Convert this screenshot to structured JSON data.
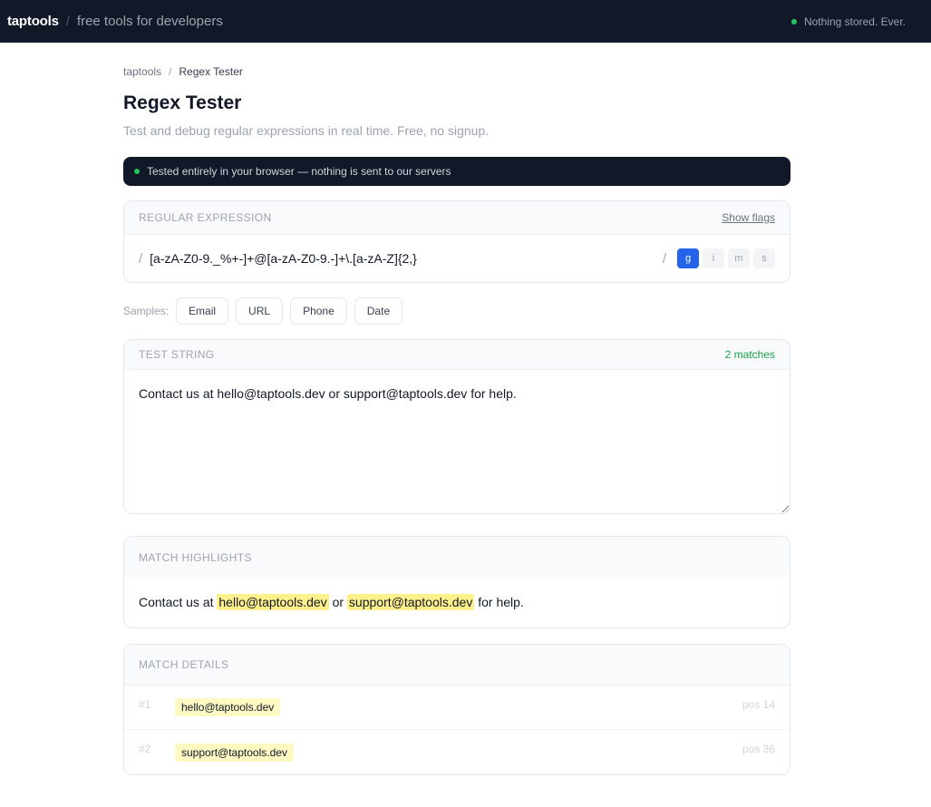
{
  "topbar": {
    "logo": "taptools",
    "separator": "/",
    "tagline": "free tools for developers",
    "status": "Nothing stored. Ever."
  },
  "breadcrumb": {
    "root": "taptools",
    "separator": "/",
    "current": "Regex Tester"
  },
  "page": {
    "title": "Regex Tester",
    "subtitle": "Test and debug regular expressions in real time. Free, no signup."
  },
  "privacy_banner": "Tested entirely in your browser — nothing is sent to our servers",
  "regex": {
    "title": "Regular Expression",
    "show_flags": "Show flags",
    "open_slash": "/",
    "close_slash": "/",
    "pattern": "[a-zA-Z0-9._%+-]+@[a-zA-Z0-9.-]+\\.[a-zA-Z]{2,}",
    "flags": [
      {
        "label": "g",
        "active": true
      },
      {
        "label": "i",
        "active": false
      },
      {
        "label": "m",
        "active": false
      },
      {
        "label": "s",
        "active": false
      }
    ]
  },
  "samples": {
    "label": "Samples:",
    "items": [
      "Email",
      "URL",
      "Phone",
      "Date"
    ]
  },
  "test_string": {
    "title": "Test String",
    "match_count": "2 matches",
    "value": "Contact us at hello@taptools.dev or support@taptools.dev for help."
  },
  "highlights": {
    "title": "Match Highlights",
    "segments": [
      {
        "text": "Contact us at ",
        "match": false
      },
      {
        "text": "hello@taptools.dev",
        "match": true
      },
      {
        "text": " or ",
        "match": false
      },
      {
        "text": "support@taptools.dev",
        "match": true
      },
      {
        "text": " for help.",
        "match": false
      }
    ]
  },
  "details": {
    "title": "Match Details",
    "rows": [
      {
        "index": "#1",
        "match": "hello@taptools.dev",
        "pos": "pos 14"
      },
      {
        "index": "#2",
        "match": "support@taptools.dev",
        "pos": "pos 36"
      }
    ]
  },
  "colors": {
    "topbar_bg": "#111827",
    "accent": "#2563eb",
    "success": "#16a34a",
    "status_dot": "#22c55e",
    "highlight": "#fef08a"
  }
}
